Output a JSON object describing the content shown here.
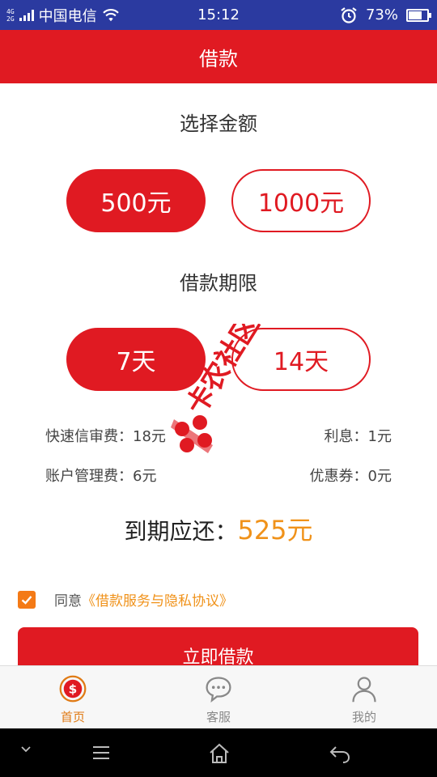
{
  "status_bar": {
    "net_top": "4G",
    "net_bottom": "2G",
    "carrier": "中国电信",
    "time": "15:12",
    "battery_percent_text": "73%",
    "battery_level": 0.73
  },
  "header": {
    "title": "借款"
  },
  "amount_section": {
    "title": "选择金额",
    "options": [
      {
        "label": "500元",
        "selected": true
      },
      {
        "label": "1000元",
        "selected": false
      }
    ]
  },
  "term_section": {
    "title": "借款期限",
    "options": [
      {
        "label": "7天",
        "selected": true
      },
      {
        "label": "14天",
        "selected": false
      }
    ]
  },
  "fees": {
    "review_fee": "快速信审费：18元",
    "interest": "利息：1元",
    "account_fee": "账户管理费：6元",
    "coupon": "优惠券：0元"
  },
  "repay": {
    "label": "到期应还：",
    "amount": "525元"
  },
  "agreement": {
    "checked": true,
    "prefix": "同意",
    "link": "《借款服务与隐私协议》"
  },
  "submit_label": "立即借款",
  "watermark_text": "卡农社区",
  "tabs": [
    {
      "label": "首页",
      "icon": "dollar-icon",
      "active": true
    },
    {
      "label": "客服",
      "icon": "chat-icon",
      "active": false
    },
    {
      "label": "我的",
      "icon": "user-icon",
      "active": false
    }
  ],
  "colors": {
    "brand_red": "#e01a22",
    "accent_orange": "#f0921a",
    "status_bar_blue": "#2b3aa0"
  }
}
